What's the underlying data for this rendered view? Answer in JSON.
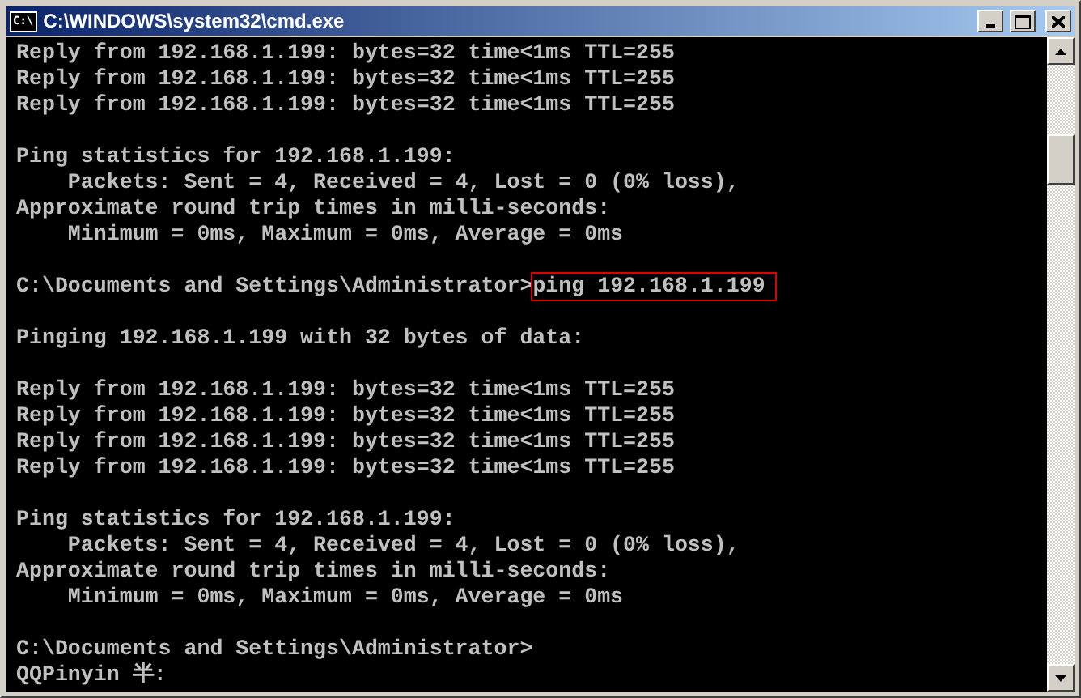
{
  "window": {
    "title": "C:\\WINDOWS\\system32\\cmd.exe",
    "icon_text": "C:\\"
  },
  "lines": [
    {
      "kind": "text",
      "text": "Reply from 192.168.1.199: bytes=32 time<1ms TTL=255"
    },
    {
      "kind": "text",
      "text": "Reply from 192.168.1.199: bytes=32 time<1ms TTL=255"
    },
    {
      "kind": "text",
      "text": "Reply from 192.168.1.199: bytes=32 time<1ms TTL=255"
    },
    {
      "kind": "blank"
    },
    {
      "kind": "text",
      "text": "Ping statistics for 192.168.1.199:"
    },
    {
      "kind": "text",
      "text": "    Packets: Sent = 4, Received = 4, Lost = 0 (0% loss),"
    },
    {
      "kind": "text",
      "text": "Approximate round trip times in milli-seconds:"
    },
    {
      "kind": "text",
      "text": "    Minimum = 0ms, Maximum = 0ms, Average = 0ms"
    },
    {
      "kind": "blank"
    },
    {
      "kind": "command",
      "prompt": "C:\\Documents and Settings\\Administrator>",
      "command": "ping 192.168.1.199",
      "highlighted": true
    },
    {
      "kind": "blank"
    },
    {
      "kind": "text",
      "text": "Pinging 192.168.1.199 with 32 bytes of data:"
    },
    {
      "kind": "blank"
    },
    {
      "kind": "text",
      "text": "Reply from 192.168.1.199: bytes=32 time<1ms TTL=255"
    },
    {
      "kind": "text",
      "text": "Reply from 192.168.1.199: bytes=32 time<1ms TTL=255"
    },
    {
      "kind": "text",
      "text": "Reply from 192.168.1.199: bytes=32 time<1ms TTL=255"
    },
    {
      "kind": "text",
      "text": "Reply from 192.168.1.199: bytes=32 time<1ms TTL=255"
    },
    {
      "kind": "blank"
    },
    {
      "kind": "text",
      "text": "Ping statistics for 192.168.1.199:"
    },
    {
      "kind": "text",
      "text": "    Packets: Sent = 4, Received = 4, Lost = 0 (0% loss),"
    },
    {
      "kind": "text",
      "text": "Approximate round trip times in milli-seconds:"
    },
    {
      "kind": "text",
      "text": "    Minimum = 0ms, Maximum = 0ms, Average = 0ms"
    },
    {
      "kind": "blank"
    },
    {
      "kind": "text",
      "text": "C:\\Documents and Settings\\Administrator>"
    },
    {
      "kind": "text",
      "text": "QQPinyin 半:"
    }
  ]
}
